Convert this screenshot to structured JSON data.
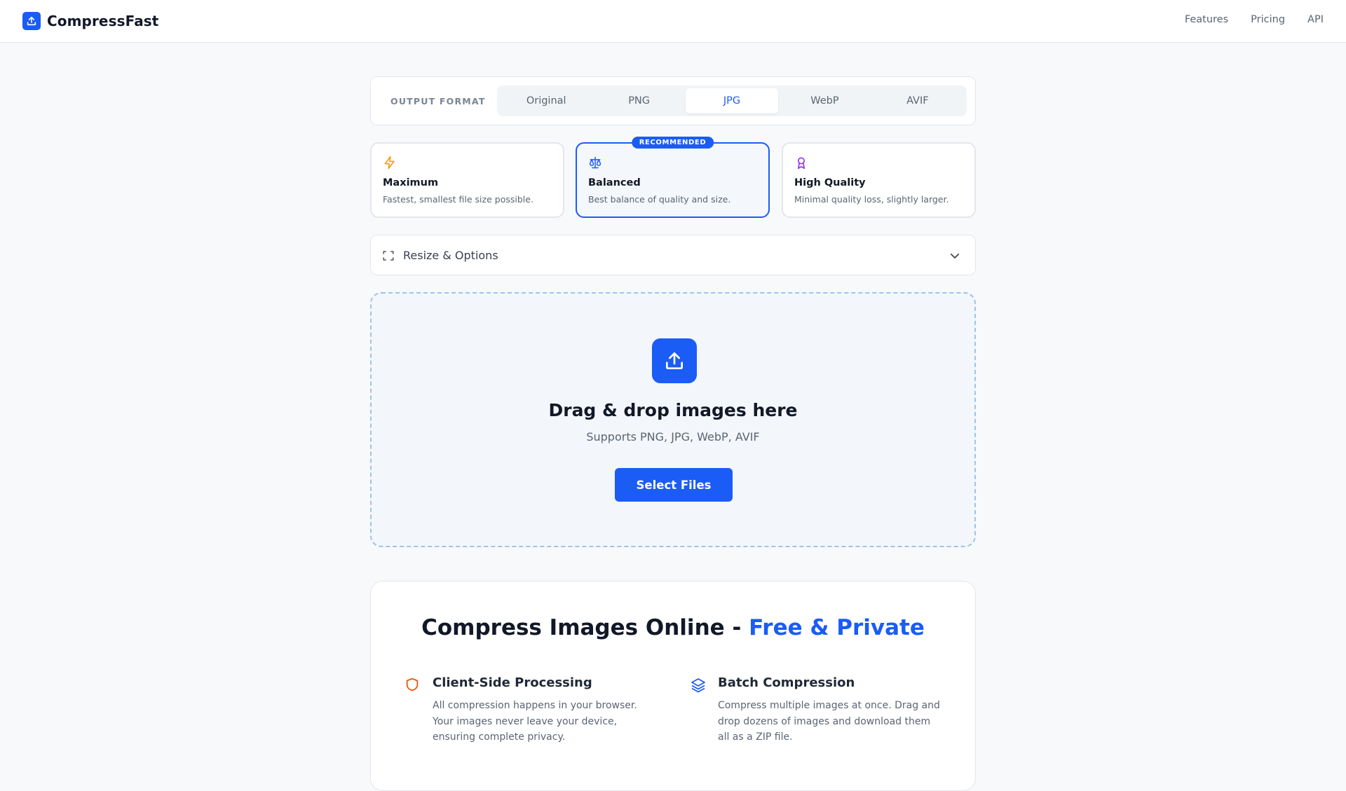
{
  "header": {
    "brand": "CompressFast",
    "brand_icon": "upload-icon",
    "nav": [
      "Features",
      "Pricing",
      "API"
    ]
  },
  "format": {
    "label": "OUTPUT FORMAT",
    "options": [
      "Original",
      "PNG",
      "JPG",
      "WebP",
      "AVIF"
    ],
    "selected": "JPG"
  },
  "presets": [
    {
      "icon": "lightning-icon",
      "title": "Maximum",
      "desc": "Fastest, smallest file size possible.",
      "color": "#f59e0b"
    },
    {
      "icon": "scale-icon",
      "title": "Balanced",
      "desc": "Best balance of quality and size.",
      "color": "#1a5cf5",
      "badge": "RECOMMENDED",
      "selected": true
    },
    {
      "icon": "award-icon",
      "title": "High Quality",
      "desc": "Minimal quality loss, slightly larger.",
      "color": "#9333ea"
    }
  ],
  "options": {
    "label": "Resize & Options",
    "icon": "resize-icon",
    "expanded": false
  },
  "dropzone": {
    "icon": "upload-icon",
    "title": "Drag & drop images here",
    "subtitle": "Supports PNG, JPG, WebP, AVIF",
    "button": "Select Files"
  },
  "info": {
    "title_prefix": "Compress Images Online - ",
    "title_accent": "Free & Private",
    "features": [
      {
        "icon": "shield-icon",
        "title": "Client-Side Processing",
        "desc": "All compression happens in your browser. Your images never leave your device, ensuring complete privacy.",
        "color": "#ea580c"
      },
      {
        "icon": "layers-icon",
        "title": "Batch Compression",
        "desc": "Compress multiple images at once. Drag and drop dozens of images and download them all as a ZIP file.",
        "color": "#1a5cf5"
      }
    ]
  },
  "colors": {
    "accent": "#1a5cf5",
    "background": "#f7f9fb",
    "text": "#111827",
    "muted": "#5b6473"
  }
}
